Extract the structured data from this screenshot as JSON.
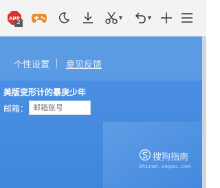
{
  "toolbar": {
    "abp": {
      "label": "ABP",
      "badge": "2",
      "icon": "adblock-icon"
    },
    "buttons": [
      "game-icon",
      "night-mode-icon",
      "download-icon",
      "screenshot-icon",
      "undo-icon",
      "new-tab-icon",
      "menu-icon"
    ]
  },
  "nav": {
    "settings_label": "个性设置",
    "feedback_label": "意见反馈"
  },
  "panel": {
    "title": "美版变形计的暴戾少年",
    "email_label": "邮箱：",
    "email_placeholder": "邮箱账号",
    "email_value": ""
  },
  "watermark": {
    "main": "搜狗指南",
    "sub": "zhinan.sogou.com"
  },
  "colors": {
    "accent": "#4a8fe0",
    "toolbar_bg": "#f3f3f3"
  }
}
